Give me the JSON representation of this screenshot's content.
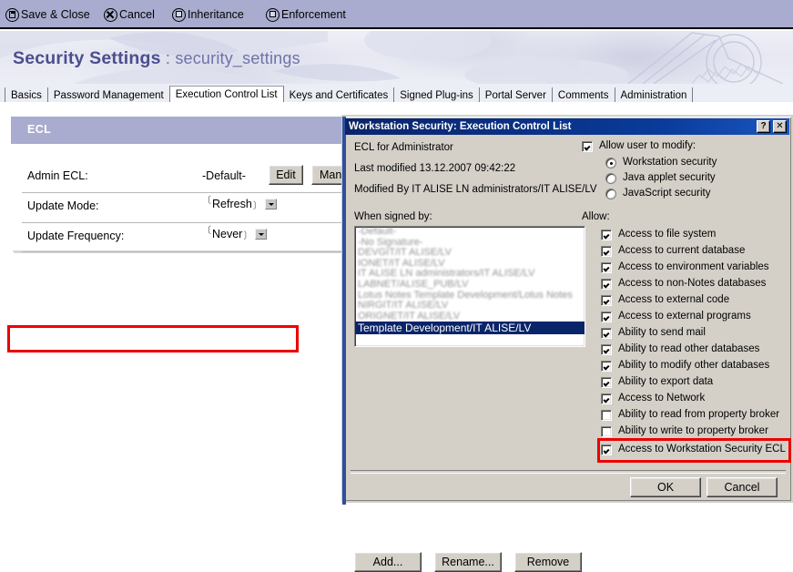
{
  "actionbar": {
    "items": [
      {
        "label": "Save & Close",
        "icon": "save-disk-icon"
      },
      {
        "label": "Cancel",
        "icon": "cancel-x-icon"
      },
      {
        "label": "Inheritance",
        "icon": "square-icon"
      },
      {
        "label": "Enforcement",
        "icon": "square-icon"
      }
    ]
  },
  "banner": {
    "title": "Security Settings",
    "separator": " : ",
    "subtitle": "security_settings",
    "title_color": "#4b4e8f"
  },
  "tabs": [
    {
      "label": "Basics",
      "active": false
    },
    {
      "label": "Password Management",
      "active": false
    },
    {
      "label": "Execution Control List",
      "active": true
    },
    {
      "label": "Keys and Certificates",
      "active": false
    },
    {
      "label": "Signed Plug-ins",
      "active": false
    },
    {
      "label": "Portal Server",
      "active": false
    },
    {
      "label": "Comments",
      "active": false
    },
    {
      "label": "Administration",
      "active": false
    }
  ],
  "form": {
    "section_header": "ECL",
    "section_header_bg": "#a9acce",
    "rows": [
      {
        "label": "Admin ECL:",
        "value": "-Default-"
      },
      {
        "label": "Update Mode:",
        "value": "Refresh"
      },
      {
        "label": "Update Frequency:",
        "value": "Never"
      }
    ],
    "buttons": [
      {
        "label": "Edit"
      },
      {
        "label": "Manage"
      }
    ],
    "highlight_color": "#ec0000"
  },
  "dialog": {
    "title": "Workstation Security:  Execution Control List",
    "titlebar_buttons": [
      {
        "label": "?",
        "name": "help-button"
      },
      {
        "label": "✕",
        "name": "close-button"
      }
    ],
    "info": {
      "ecl_for_label": "ECL for  Administrator",
      "last_modified": "Last modified  13.12.2007 09:42:22",
      "modified_by": "Modified By  IT ALISE LN administrators/IT ALISE/LV"
    },
    "list": {
      "label": "When signed by:",
      "items": [
        {
          "text": "-Default-",
          "selected": false,
          "blurred": true
        },
        {
          "text": "-No Signature-",
          "selected": false,
          "blurred": true
        },
        {
          "text": "DEVGIT/IT ALISE/LV",
          "selected": false,
          "blurred": true
        },
        {
          "text": "IONET/IT ALISE/LV",
          "selected": false,
          "blurred": true
        },
        {
          "text": "IT ALISE LN administrators/IT ALISE/LV",
          "selected": false,
          "blurred": true
        },
        {
          "text": "LABNET/ALISE_PUB/LV",
          "selected": false,
          "blurred": true
        },
        {
          "text": "Lotus Notes Template Development/Lotus Notes",
          "selected": false,
          "blurred": true
        },
        {
          "text": "NIRGIT/IT ALISE/LV",
          "selected": false,
          "blurred": true
        },
        {
          "text": "ORIGNET/IT ALISE/LV",
          "selected": false,
          "blurred": true
        },
        {
          "text": "Template Development/IT ALISE/LV",
          "selected": true,
          "blurred": false
        }
      ],
      "selection_bg": "#0a246a"
    },
    "list_buttons": [
      {
        "label": "Add..."
      },
      {
        "label": "Rename..."
      },
      {
        "label": "Remove"
      }
    ],
    "allow_modify": {
      "label": "Allow user to modify:",
      "checked": true,
      "options": [
        {
          "label": "Workstation security",
          "selected": true
        },
        {
          "label": "Java applet security",
          "selected": false
        },
        {
          "label": "JavaScript security",
          "selected": false
        }
      ]
    },
    "allow": {
      "label": "Allow:",
      "permissions": [
        {
          "label": "Access to file system",
          "checked": true,
          "highlighted": false
        },
        {
          "label": "Access to current database",
          "checked": true,
          "highlighted": false
        },
        {
          "label": "Access to environment variables",
          "checked": true,
          "highlighted": false
        },
        {
          "label": "Access to non-Notes databases",
          "checked": true,
          "highlighted": false
        },
        {
          "label": "Access to external code",
          "checked": true,
          "highlighted": false
        },
        {
          "label": "Access to external programs",
          "checked": true,
          "highlighted": false
        },
        {
          "label": "Ability to send mail",
          "checked": true,
          "highlighted": false
        },
        {
          "label": "Ability to read other databases",
          "checked": true,
          "highlighted": false
        },
        {
          "label": "Ability to modify other databases",
          "checked": true,
          "highlighted": false
        },
        {
          "label": "Ability to export data",
          "checked": true,
          "highlighted": false
        },
        {
          "label": "Access to Network",
          "checked": true,
          "highlighted": false
        },
        {
          "label": "Ability to read from property broker",
          "checked": false,
          "highlighted": false
        },
        {
          "label": "Ability to write to property broker",
          "checked": false,
          "highlighted": false
        },
        {
          "label": "Access to Workstation Security ECL",
          "checked": true,
          "highlighted": true
        }
      ]
    },
    "footer_buttons": [
      {
        "label": "OK"
      },
      {
        "label": "Cancel"
      }
    ]
  }
}
